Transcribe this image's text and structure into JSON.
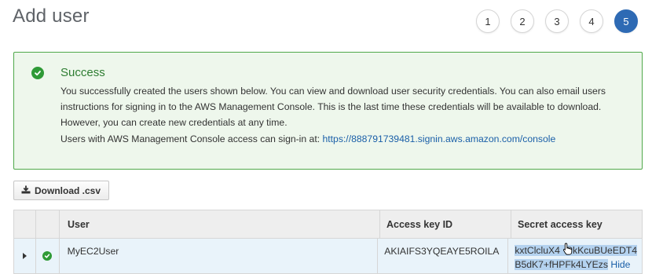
{
  "page": {
    "title": "Add user"
  },
  "steps": [
    "1",
    "2",
    "3",
    "4",
    "5"
  ],
  "active_step": "5",
  "success": {
    "title": "Success",
    "message": "You successfully created the users shown below. You can view and download user security credentials. You can also email users instructions for signing in to the AWS Management Console. This is the last time these credentials will be available to download. However, you can create new credentials at any time.",
    "signin_text": "Users with AWS Management Console access can sign-in at: ",
    "signin_url": "https://888791739481.signin.aws.amazon.com/console"
  },
  "download_button": {
    "label": "Download .csv"
  },
  "table": {
    "headers": {
      "user": "User",
      "access_key_id": "Access key ID",
      "secret_access_key": "Secret access key"
    },
    "rows": [
      {
        "user": "MyEC2User",
        "access_key_id": "AKIAIFS3YQEAYE5ROILA",
        "secret_line1": "kxtClcluX4",
        "secret_line1b": "PkKcuBUeEDT4",
        "secret_line2": "B5dK7+fHPFk4LYEzs",
        "hide_label": "Hide"
      }
    ]
  },
  "colors": {
    "accent": "#2e6ab4",
    "success": "#2f9a36",
    "link": "#1a5fa8"
  },
  "icons": [
    "check-circle-icon",
    "download-icon",
    "caret-right-icon",
    "hand-cursor-icon"
  ]
}
